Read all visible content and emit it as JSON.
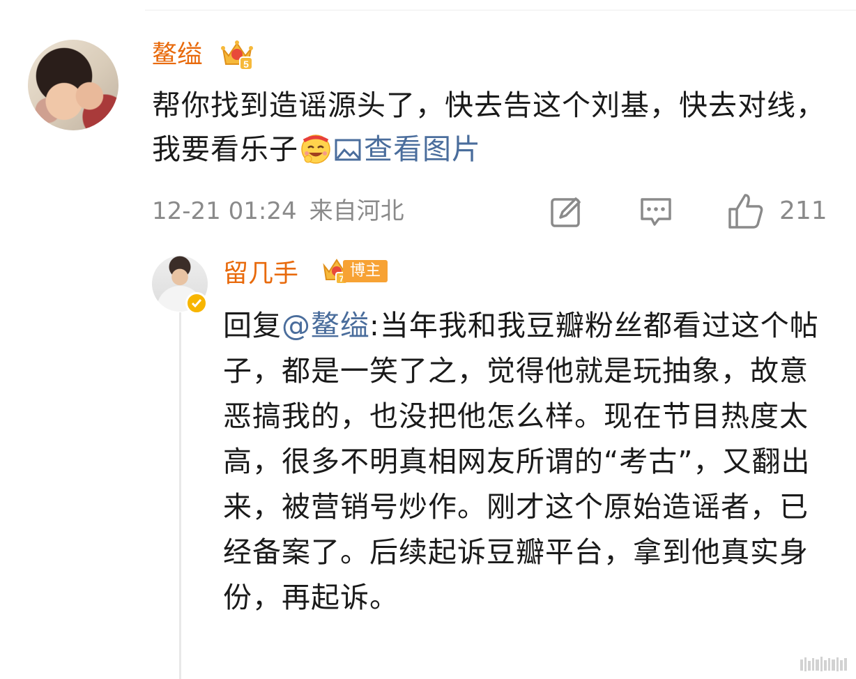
{
  "comment": {
    "username": "鳌缢",
    "text_before_emoji": "帮你找到造谣源头了，快去告这个刘基，快去对线，我要看乐子",
    "emoji_icon": "laughing-face-emoji",
    "view_image_label": "查看图片",
    "timestamp": "12-21 01:24",
    "location": "来自河北",
    "like_count": "211",
    "icons": [
      "repost-icon",
      "comment-icon",
      "like-icon"
    ]
  },
  "reply": {
    "username": "留几手",
    "badge_label": "博主",
    "reply_prefix": "回复",
    "mention": "@鳌缢",
    "text": ":当年我和我豆瓣粉丝都看过这个帖子，都是一笑了之，觉得他就是玩抽象，故意恶搞我的，也没把他怎么样。现在节目热度太高，很多不明真相网友所谓的“考古”，又翻出来，被营销号炒作。刚才这个原始造谣者，已经备案了。后续起诉豆瓣平台，拿到他真实身份，再起诉。"
  },
  "colors": {
    "username": "#e86a0c",
    "link": "#4a6d9c",
    "meta": "#8a8a8a",
    "badge": "#f7a234"
  }
}
